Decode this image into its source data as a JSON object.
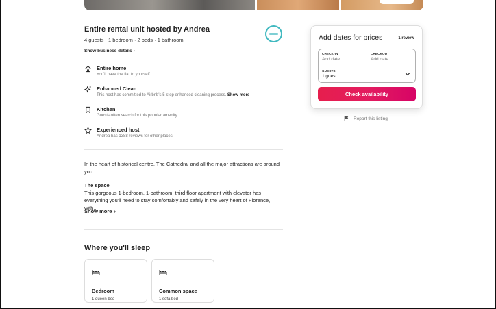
{
  "listing": {
    "title": "Entire rental unit hosted by Andrea",
    "summary": "4 guests · 1 bedroom · 2 beds · 1 bathroom",
    "business_link": "Show business details"
  },
  "highlights": [
    {
      "icon": "home-icon",
      "name": "Entire home",
      "desc": "You'll have the flat to yourself."
    },
    {
      "icon": "sparkle-icon",
      "name": "Enhanced Clean",
      "desc": "This host has committed to Airbnb's 5-step enhanced cleaning process.",
      "more": "Show more"
    },
    {
      "icon": "bookmark-icon",
      "name": "Kitchen",
      "desc": "Guests often search for this popular amenity"
    },
    {
      "icon": "star-icon",
      "name": "Experienced host",
      "desc": "Andrea has 1388 reviews for other places."
    }
  ],
  "description": {
    "intro_line1": "In the heart of historical centre. The Cathedral and all the major attractions are around",
    "intro_line2": "you.",
    "space_heading": "The space",
    "space_line1": "This gorgeous 1-bedroom, 1-bathroom, third floor apartment with elevator has",
    "space_line2": "everything you'll need to stay comfortably and safely in the very heart of Florence, with...",
    "show_more": "Show more"
  },
  "sleep": {
    "title": "Where you'll sleep",
    "rooms": [
      {
        "name": "Bedroom",
        "beds": "1 queen bed"
      },
      {
        "name": "Common space",
        "beds": "1 sofa bed"
      }
    ]
  },
  "booking": {
    "title": "Add dates for prices",
    "reviews": "1 review",
    "checkin_label": "CHECK-IN",
    "checkin_placeholder": "Add date",
    "checkout_label": "CHECKOUT",
    "checkout_placeholder": "Add date",
    "guests_label": "GUESTS",
    "guests_value": "1 guest",
    "button": "Check availability"
  },
  "report": "Report this listing",
  "colors": {
    "accent": "#e31c5f",
    "host_ring": "#41b9c0"
  }
}
